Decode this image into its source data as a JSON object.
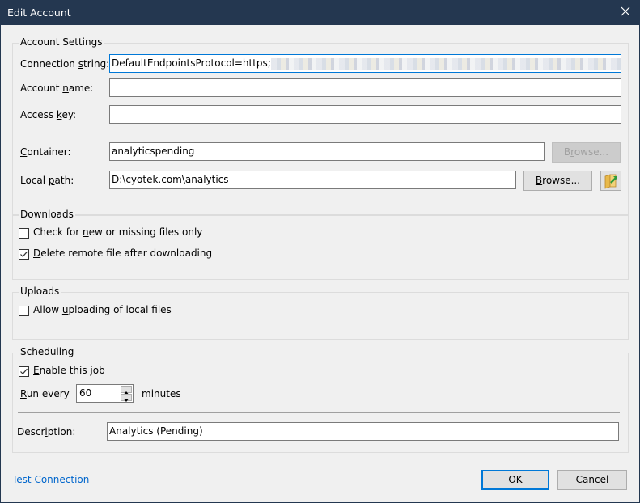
{
  "window": {
    "title": "Edit Account",
    "close_icon": "close-icon"
  },
  "account_settings": {
    "group_title": "Account Settings",
    "connection_string": {
      "label_pre": "Connection ",
      "label_accel": "s",
      "label_post": "tring:",
      "value": "DefaultEndpointsProtocol=https;"
    },
    "account_name": {
      "label_pre": "Account ",
      "label_accel": "n",
      "label_post": "ame:",
      "value": ""
    },
    "access_key": {
      "label_pre": "Access ",
      "label_accel": "k",
      "label_post": "ey:",
      "value": ""
    },
    "container": {
      "label_pre": "",
      "label_accel": "C",
      "label_post": "ontainer:",
      "value": "analyticspending",
      "browse_pre": "B",
      "browse_accel": "r",
      "browse_post": "owse...",
      "browse_enabled": false
    },
    "local_path": {
      "label_pre": "Local ",
      "label_accel": "p",
      "label_post": "ath:",
      "value": "D:\\cyotek.com\\analytics",
      "browse_pre": "",
      "browse_accel": "B",
      "browse_post": "rowse...",
      "open_folder_icon": "open-folder-icon"
    }
  },
  "downloads": {
    "group_title": "Downloads",
    "check_new": {
      "label_pre": "Check for ",
      "label_accel": "n",
      "label_post": "ew or missing files only",
      "checked": false
    },
    "delete_remote": {
      "label_pre": "",
      "label_accel": "D",
      "label_post": "elete remote file after downloading",
      "checked": true
    }
  },
  "uploads": {
    "group_title": "Uploads",
    "allow_uploading": {
      "label_pre": "Allow ",
      "label_accel": "u",
      "label_post": "ploading of local files",
      "checked": false
    }
  },
  "scheduling": {
    "group_title": "Scheduling",
    "enable_job": {
      "label_pre": "",
      "label_accel": "E",
      "label_post": "nable this job",
      "checked": true
    },
    "run_every": {
      "label_pre": "",
      "label_accel": "R",
      "label_post": "un every",
      "value": "60",
      "unit": "minutes"
    },
    "description": {
      "label_pre": "Descr",
      "label_accel": "i",
      "label_post": "ption:",
      "value": "Analytics (Pending)"
    }
  },
  "footer": {
    "test_connection": "Test Connection",
    "ok": "OK",
    "cancel": "Cancel"
  },
  "colors": {
    "titlebar": "#243750",
    "focus": "#0078d7",
    "link": "#0066cc"
  }
}
